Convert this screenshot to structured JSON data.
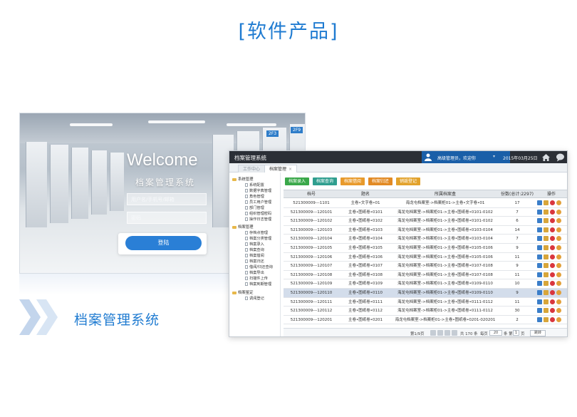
{
  "hero": {
    "title": "[软件产品]"
  },
  "caption": {
    "text": "档案管理系统"
  },
  "login": {
    "welcome": "Welcome",
    "subtitle": "档案管理系统",
    "username_placeholder": "用户名/手机号/邮箱",
    "password_placeholder": "密码",
    "login_button": "登陆",
    "rack_labels": [
      "2F9",
      "2F3"
    ]
  },
  "app": {
    "title": "档案管理系统",
    "user_greeting": "高级管理员，欢迎你",
    "date": "2015年03月25日",
    "tabs": [
      {
        "label": "工作中心"
      },
      {
        "label": "档案管理",
        "close": "×"
      }
    ],
    "sidebar": [
      {
        "group": "系统管理",
        "items": [
          "系统配置",
          "数据字典管理",
          "角色管理",
          "员工用户管理",
          "部门管理",
          "组织管理密码",
          "操作日志管理"
        ]
      },
      {
        "group": "档案管理",
        "items": [
          "存档点管理",
          "档案分类管理",
          "档案录入",
          "档案查询",
          "档案借阅",
          "档案归还",
          "借阅/归还查询",
          "档案导出",
          "扫描件上传",
          "档案到期管理"
        ]
      },
      {
        "group": "档案鉴定",
        "items": [
          "调阅登记"
        ]
      }
    ],
    "actions": [
      {
        "label": "档案录入",
        "color": "#3aa84a"
      },
      {
        "label": "档案查询",
        "color": "#2f9e8f"
      },
      {
        "label": "档案借阅",
        "color": "#e89a2c"
      },
      {
        "label": "档案归还",
        "color": "#e28a24"
      },
      {
        "label": "销毁登记",
        "color": "#e2a22c"
      }
    ],
    "table": {
      "headers": [
        "档号",
        "题名",
        "所属档案盒",
        "份数(总计:2297)",
        "操作"
      ],
      "rows": [
        [
          "521300009---1101",
          "主卷•文字卷•01",
          "海龙屯档案室->档案柜01->主卷•文字卷•01",
          "17"
        ],
        [
          "521300009---120101",
          "主卷•图纸卷•0101",
          "海龙屯档案室->档案柜01->主卷•图纸卷•0101-0102",
          "7"
        ],
        [
          "521300009---120102",
          "主卷•图纸卷•0102",
          "海龙屯档案室->档案柜01->主卷•图纸卷•0101-0102",
          "6"
        ],
        [
          "521300009---120103",
          "主卷•图纸卷•0103",
          "海龙屯档案室->档案柜01->主卷•图纸卷•0103-0104",
          "14"
        ],
        [
          "521300009---120104",
          "主卷•图纸卷•0104",
          "海龙屯档案室->档案柜01->主卷•图纸卷•0103-0104",
          "7"
        ],
        [
          "521300009---120105",
          "主卷•图纸卷•0105",
          "海龙屯档案室->档案柜01->主卷•图纸卷•0105-0106",
          "9"
        ],
        [
          "521300009---120106",
          "主卷•图纸卷•0106",
          "海龙屯档案室->档案柜01->主卷•图纸卷•0105-0106",
          "11"
        ],
        [
          "521300009---120107",
          "主卷•图纸卷•0107",
          "海龙屯档案室->档案柜01->主卷•图纸卷•0107-0108",
          "9"
        ],
        [
          "521300009---120108",
          "主卷•图纸卷•0108",
          "海龙屯档案室->档案柜01->主卷•图纸卷•0107-0108",
          "11"
        ],
        [
          "521300009---120109",
          "主卷•图纸卷•0109",
          "海龙屯档案室->档案柜01->主卷•图纸卷•0109-0110",
          "10"
        ],
        [
          "521300009---120110",
          "主卷•图纸卷•0110",
          "海龙屯档案室->档案柜01->主卷•图纸卷•0109-0110",
          "9"
        ],
        [
          "521300009---120111",
          "主卷•图纸卷•0111",
          "海龙屯档案室->档案柜01->主卷•图纸卷•0111-0112",
          "11"
        ],
        [
          "521300009---120112",
          "主卷•图纸卷•0112",
          "海龙屯档案室->档案柜01->主卷•图纸卷•0111-0112",
          "30"
        ],
        [
          "521300009---120201",
          "主卷•图纸卷•0201",
          "海龙屯档案室->档案柜01->主卷•图纸卷•0201-020201",
          "2"
        ]
      ],
      "selected_row": 10
    },
    "pager": {
      "page_info": "第1/9页",
      "total": "共 170 条",
      "per_page_label": "每页",
      "per_page_value": "20",
      "goto_label": "条 第",
      "goto_value": "1",
      "page_unit": "页",
      "go_button": "跳转"
    },
    "colors": {
      "titlebar": "#2b2f36",
      "user_box": "#1a5fa8",
      "accent": "#1f7bd1"
    }
  }
}
